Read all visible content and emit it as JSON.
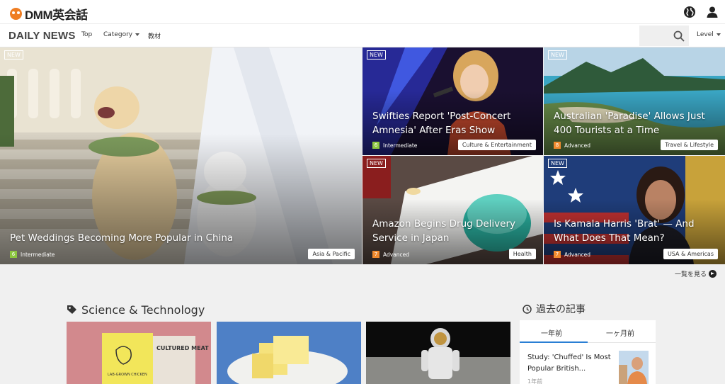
{
  "header": {
    "logo_text": "DMM英会話",
    "icons": [
      "globe-icon",
      "user-icon"
    ]
  },
  "nav": {
    "brand": "DAILY NEWS",
    "top": "Top",
    "category": "Category",
    "materials": "教材",
    "level": "Level"
  },
  "featured": [
    {
      "new": "NEW",
      "title": "Pet Weddings Becoming More Popular in China",
      "level_num": "6",
      "level": "Intermediate",
      "level_color": "#8cc63f",
      "category": "Asia & Pacific"
    },
    {
      "new": "NEW",
      "title": "Swifties Report 'Post-Concert Amnesia' After Eras Show",
      "level_num": "6",
      "level": "Intermediate",
      "level_color": "#8cc63f",
      "category": "Culture & Entertainment"
    },
    {
      "new": "NEW",
      "title": "Australian 'Paradise' Allows Just 400 Tourists at a Time",
      "level_num": "8",
      "level": "Advanced",
      "level_color": "#f08a2e",
      "category": "Travel & Lifestyle"
    },
    {
      "new": "NEW",
      "title": "Amazon Begins Drug Delivery Service in Japan",
      "level_num": "7",
      "level": "Advanced",
      "level_color": "#f08a2e",
      "category": "Health"
    },
    {
      "new": "NEW",
      "title": "Is Kamala Harris 'Brat' — And What Does That Mean?",
      "level_num": "7",
      "level": "Advanced",
      "level_color": "#f08a2e",
      "category": "USA & Americas"
    }
  ],
  "see_all": "一覧を見る",
  "section": {
    "title": "Science & Technology",
    "card_labels": [
      "CULTURED MEAT",
      "LAB-GROWN CHICKEN"
    ]
  },
  "past": {
    "title": "過去の記事",
    "tab_year": "一年前",
    "tab_month": "一ヶ月前",
    "item_title": "Study: 'Chuffed' Is Most Popular British...",
    "item_meta": "1年前"
  }
}
